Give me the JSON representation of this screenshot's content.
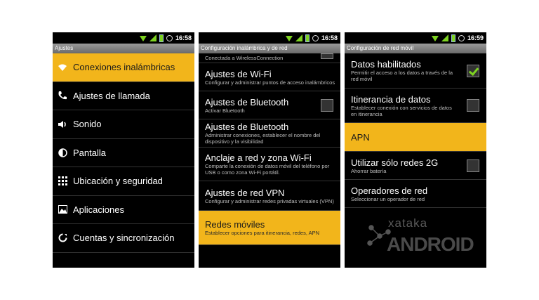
{
  "time1": "16:58",
  "time2": "16:58",
  "time3": "16:59",
  "screen1": {
    "title": "Ajustes",
    "items": [
      {
        "label": "Conexiones inalámbricas",
        "icon": "wifi-icon"
      },
      {
        "label": "Ajustes de llamada",
        "icon": "phone-icon"
      },
      {
        "label": "Sonido",
        "icon": "speaker-icon"
      },
      {
        "label": "Pantalla",
        "icon": "display-icon"
      },
      {
        "label": "Ubicación y seguridad",
        "icon": "grid-icon"
      },
      {
        "label": "Aplicaciones",
        "icon": "apps-icon"
      },
      {
        "label": "Cuentas y sincronización",
        "icon": "sync-icon"
      }
    ]
  },
  "screen2": {
    "title": "Configuración inalámbrica y de red",
    "top_sub": "Conectada a WirelessConnection",
    "items": [
      {
        "label": "Ajustes de Wi-Fi",
        "sub": "Configurar y administrar puntos de acceso inalámbricos"
      },
      {
        "label": "Ajustes de Bluetooth",
        "sub": "Activar Bluetooth"
      },
      {
        "label": "Ajustes de Bluetooth",
        "sub": "Administrar conexiones, establecer el nombre del dispositivo y la visibilidad"
      },
      {
        "label": "Anclaje a red y zona Wi-Fi",
        "sub": "Comparte la conexión de datos móvil del teléfono por USB o como zona Wi-Fi portátil."
      },
      {
        "label": "Ajustes de red VPN",
        "sub": "Configurar y administrar redes privadas virtuales (VPN)"
      },
      {
        "label": "Redes móviles",
        "sub": "Establecer opciones para itinerancia, redes, APN"
      }
    ]
  },
  "screen3": {
    "title": "Configuración de red móvil",
    "items": [
      {
        "label": "Datos habilitados",
        "sub": "Permitir el acceso a los datos a través de la red móvil",
        "checked": true
      },
      {
        "label": "Itinerancia de datos",
        "sub": "Establecer conexión con servicios de datos en itinerancia",
        "checked": false
      },
      {
        "label": "APN",
        "sub": ""
      },
      {
        "label": "Utilizar sólo redes 2G",
        "sub": "Ahorrar batería",
        "checked": false
      },
      {
        "label": "Operadores de red",
        "sub": "Seleccionar un operador de red"
      }
    ],
    "watermark_top": "xataka",
    "watermark_bottom": "ANDROID"
  },
  "colors": {
    "highlight": "#f2b51b",
    "status_green": "#7ed321"
  }
}
